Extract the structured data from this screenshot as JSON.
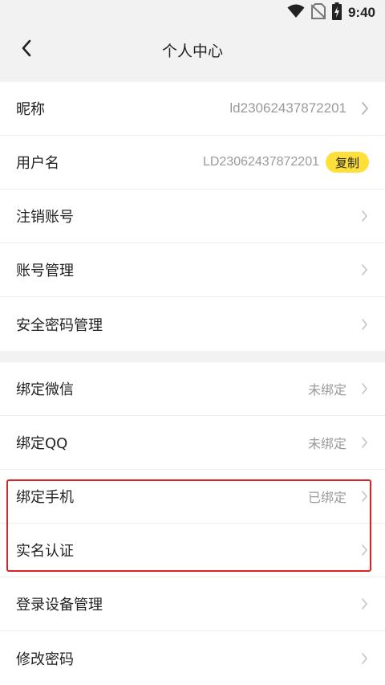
{
  "status_bar": {
    "time": "9:40",
    "icons": [
      "wifi-icon",
      "no-sim-icon",
      "battery-charging-icon"
    ]
  },
  "header": {
    "title": "个人中心",
    "back_icon": "chevron-left-icon"
  },
  "profile_group": [
    {
      "label": "昵称",
      "value": "ld23062437872201"
    },
    {
      "label": "用户名",
      "value": "LD23062437872201",
      "action": "复制"
    },
    {
      "label": "注销账号"
    },
    {
      "label": "账号管理"
    },
    {
      "label": "安全密码管理"
    }
  ],
  "binding_group": [
    {
      "label": "绑定微信",
      "status": "未绑定"
    },
    {
      "label": "绑定QQ",
      "status": "未绑定"
    },
    {
      "label": "绑定手机",
      "status": "已绑定"
    },
    {
      "label": "实名认证"
    },
    {
      "label": "登录设备管理"
    },
    {
      "label": "修改密码"
    }
  ],
  "colors": {
    "accent": "#ffe03a",
    "highlight": "#e02020",
    "muted_text": "#9a9a9a",
    "background": "#f2f2f2"
  }
}
